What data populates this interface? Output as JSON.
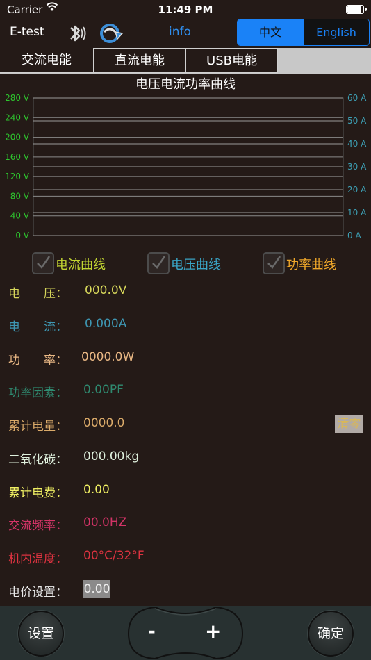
{
  "status_bar": {
    "carrier": "Carrier",
    "time": "11:49 PM"
  },
  "nav": {
    "title": "E-test",
    "info_label": "info",
    "bluetooth_icon": "bluetooth-icon",
    "sync_icon": "sync-icon"
  },
  "language": {
    "options": [
      "中文",
      "English"
    ],
    "selected": "中文"
  },
  "tabs": [
    "交流电能",
    "直流电能",
    "USB电能"
  ],
  "chart_data": {
    "type": "line",
    "title": "电压电流功率曲线",
    "y_left": {
      "ticks": [
        "0 V",
        "40 V",
        "80 V",
        "120 V",
        "160 V",
        "200 V",
        "240 V",
        "280 V"
      ],
      "ylim": [
        0,
        280
      ],
      "color": "#2ec52e"
    },
    "y_right": {
      "ticks": [
        "0 A",
        "10 A",
        "20 A",
        "30 A",
        "40 A",
        "50 A",
        "60 A"
      ],
      "ylim": [
        0,
        60
      ],
      "color": "#3d9fb4"
    },
    "grid": true,
    "series": []
  },
  "checkboxes": [
    {
      "label": "电流曲线",
      "color": "#c2d532",
      "checked": true
    },
    {
      "label": "电压曲线",
      "color": "#3aa4c5",
      "checked": true
    },
    {
      "label": "功率曲线",
      "color": "#f0a82a",
      "checked": true
    }
  ],
  "readings": [
    {
      "label": "电　　压：",
      "value": "000.0V",
      "color": "#d6d65a"
    },
    {
      "label": "电　　流：",
      "value": "0.000A",
      "color": "#3e96b2"
    },
    {
      "label": "功　　率：",
      "value": "0000.0W",
      "color": "#e8b784"
    },
    {
      "label": "功率因素：",
      "value": "0.00PF",
      "color": "#2f8a70"
    },
    {
      "label": "累计电量：",
      "value": "0000.0",
      "color": "#dbab6a"
    },
    {
      "label": "二氧化碳：",
      "value": "000.00kg",
      "color": "#dff1de"
    },
    {
      "label": "累计电费：",
      "value": "0.00",
      "color": "#f0f063"
    },
    {
      "label": "交流频率：",
      "value": "00.0HZ",
      "color": "#d33467"
    },
    {
      "label": "机内温度：",
      "value": "00°C/32°F",
      "color": "#dc3340"
    },
    {
      "label": "电价设置：",
      "value": "0.00",
      "color": "#e8e8e8"
    }
  ],
  "clear_button": "清零",
  "bottom": {
    "settings": "设置",
    "minus": "-",
    "plus": "+",
    "confirm": "确定"
  }
}
